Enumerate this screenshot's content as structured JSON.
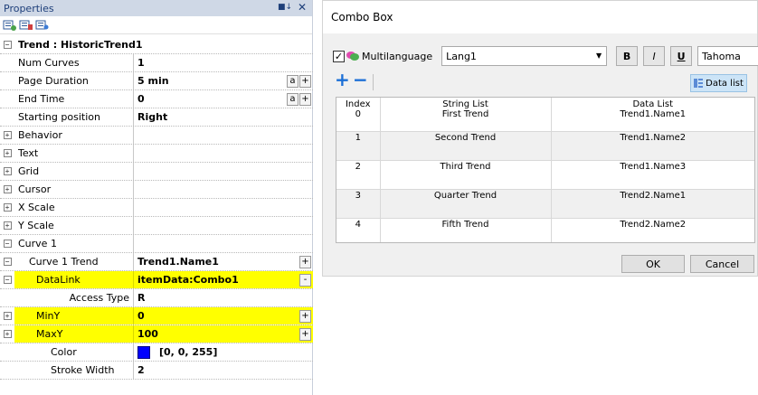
{
  "properties": {
    "title": "Properties",
    "header": "Trend : HistoricTrend1",
    "rows": [
      {
        "name": "Num Curves",
        "value": "1"
      },
      {
        "name": "Page Duration",
        "value": "5 min"
      },
      {
        "name": "End Time",
        "value": "0"
      },
      {
        "name": "Starting position",
        "value": "Right"
      },
      {
        "name": "Behavior"
      },
      {
        "name": "Text"
      },
      {
        "name": "Grid"
      },
      {
        "name": "Cursor"
      },
      {
        "name": "X Scale"
      },
      {
        "name": "Y Scale"
      },
      {
        "name": "Curve 1"
      },
      {
        "name": "Curve 1 Trend",
        "value": "Trend1.Name1"
      },
      {
        "name": "DataLink",
        "value": "itemData:Combo1"
      },
      {
        "name": "Access Type",
        "value": "R"
      },
      {
        "name": "MinY",
        "value": "0"
      },
      {
        "name": "MaxY",
        "value": "100"
      },
      {
        "name": "Color",
        "value": "[0, 0, 255]"
      },
      {
        "name": "Stroke Width",
        "value": "2"
      }
    ],
    "btn_a": "a",
    "btn_plus": "+",
    "btn_minus": "-",
    "expand_plus": "+",
    "expand_minus": "−"
  },
  "dialog": {
    "title": "Combo Box",
    "multilanguage_label": "Multilanguage",
    "language": "Lang1",
    "bold": "B",
    "italic": "I",
    "underline": "U",
    "font": "Tahoma",
    "datalist_button": "Data list",
    "ok": "OK",
    "cancel": "Cancel",
    "columns": [
      "Index",
      "String List",
      "Data List"
    ],
    "rows": [
      [
        "0",
        "First Trend",
        "Trend1.Name1"
      ],
      [
        "1",
        "Second Trend",
        "Trend1.Name2"
      ],
      [
        "2",
        "Third Trend",
        "Trend1.Name3"
      ],
      [
        "3",
        "Quarter Trend",
        "Trend2.Name1"
      ],
      [
        "4",
        "Fifth Trend",
        "Trend2.Name2"
      ]
    ]
  },
  "colors": {
    "highlight": "#ffff00",
    "swatch": "#0000ff",
    "accent": "#1b6fd6"
  }
}
